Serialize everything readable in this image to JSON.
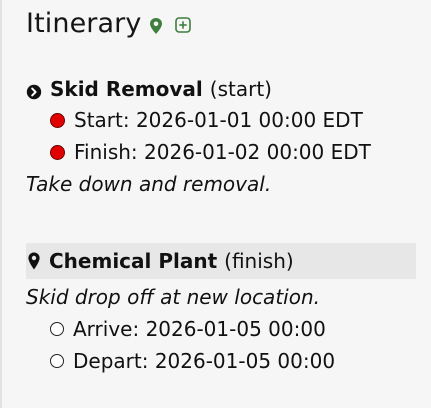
{
  "itinerary": {
    "title": "Itinerary",
    "icons": {
      "header_pin": "map-pin-icon",
      "add": "add-icon"
    },
    "colors": {
      "accent_green": "#3f7f3f",
      "dot_red": "#e00000",
      "highlight_bg": "#e7e7e7"
    },
    "stops": [
      {
        "icon": "chevron-circle-icon",
        "name": "Skid Removal",
        "role": "(start)",
        "events": [
          {
            "status": "filled",
            "text": "Start: 2026-01-01 00:00 EDT"
          },
          {
            "status": "filled",
            "text": "Finish: 2026-01-02 00:00 EDT"
          }
        ],
        "note": "Take down and removal."
      },
      {
        "icon": "location-pin-icon",
        "name": "Chemical Plant",
        "role": "(finish)",
        "note": "Skid drop off at new location.",
        "events": [
          {
            "status": "hollow",
            "text": "Arrive: 2026-01-05 00:00"
          },
          {
            "status": "hollow",
            "text": "Depart: 2026-01-05 00:00"
          }
        ]
      }
    ]
  }
}
